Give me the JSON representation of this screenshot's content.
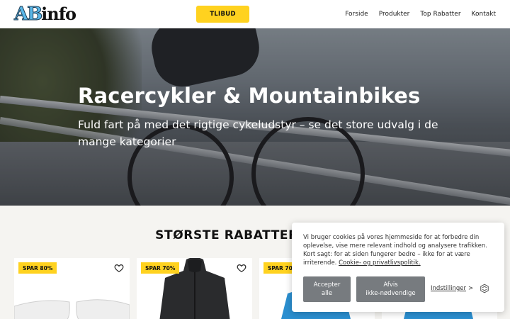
{
  "header": {
    "logo_ab": "AB",
    "logo_info": "info",
    "cta_label": "TLIBUD",
    "nav": [
      "Forside",
      "Produkter",
      "Top Rabatter",
      "Kontakt"
    ]
  },
  "hero": {
    "title": "Racercykler & Mountainbikes",
    "subtitle": "Fuld fart på med det rigtige cykeludstyr – se det store udvalg i de mange kategorier"
  },
  "section": {
    "title": "STØRSTE RABATTER",
    "cards": [
      {
        "badge": "SPAR 80%"
      },
      {
        "badge": "SPAR 70%"
      },
      {
        "badge": "SPAR 70%"
      },
      {
        "badge": ""
      }
    ]
  },
  "cookie": {
    "text": "Vi bruger cookies på vores hjemmeside for at forbedre din oplevelse, vise mere relevant indhold og analysere trafikken. Kort sagt: for at siden fungerer bedre – ikke for at være irriterende.",
    "policy_link": "Cookie- og privatlivspolitik.",
    "accept_line1": "Accepter",
    "accept_line2": "alle",
    "reject_line1": "Afvis",
    "reject_line2": "ikke-nødvendige",
    "settings_label": "Indstillinger",
    "settings_chevron": ">"
  },
  "colors": {
    "accent_yellow": "#ffd21f",
    "cookie_button": "#777b7f",
    "section_bg": "#f5f4f1"
  },
  "icons": [
    "heart-icon",
    "cookieyes-logo-icon",
    "chevron-right-icon"
  ]
}
